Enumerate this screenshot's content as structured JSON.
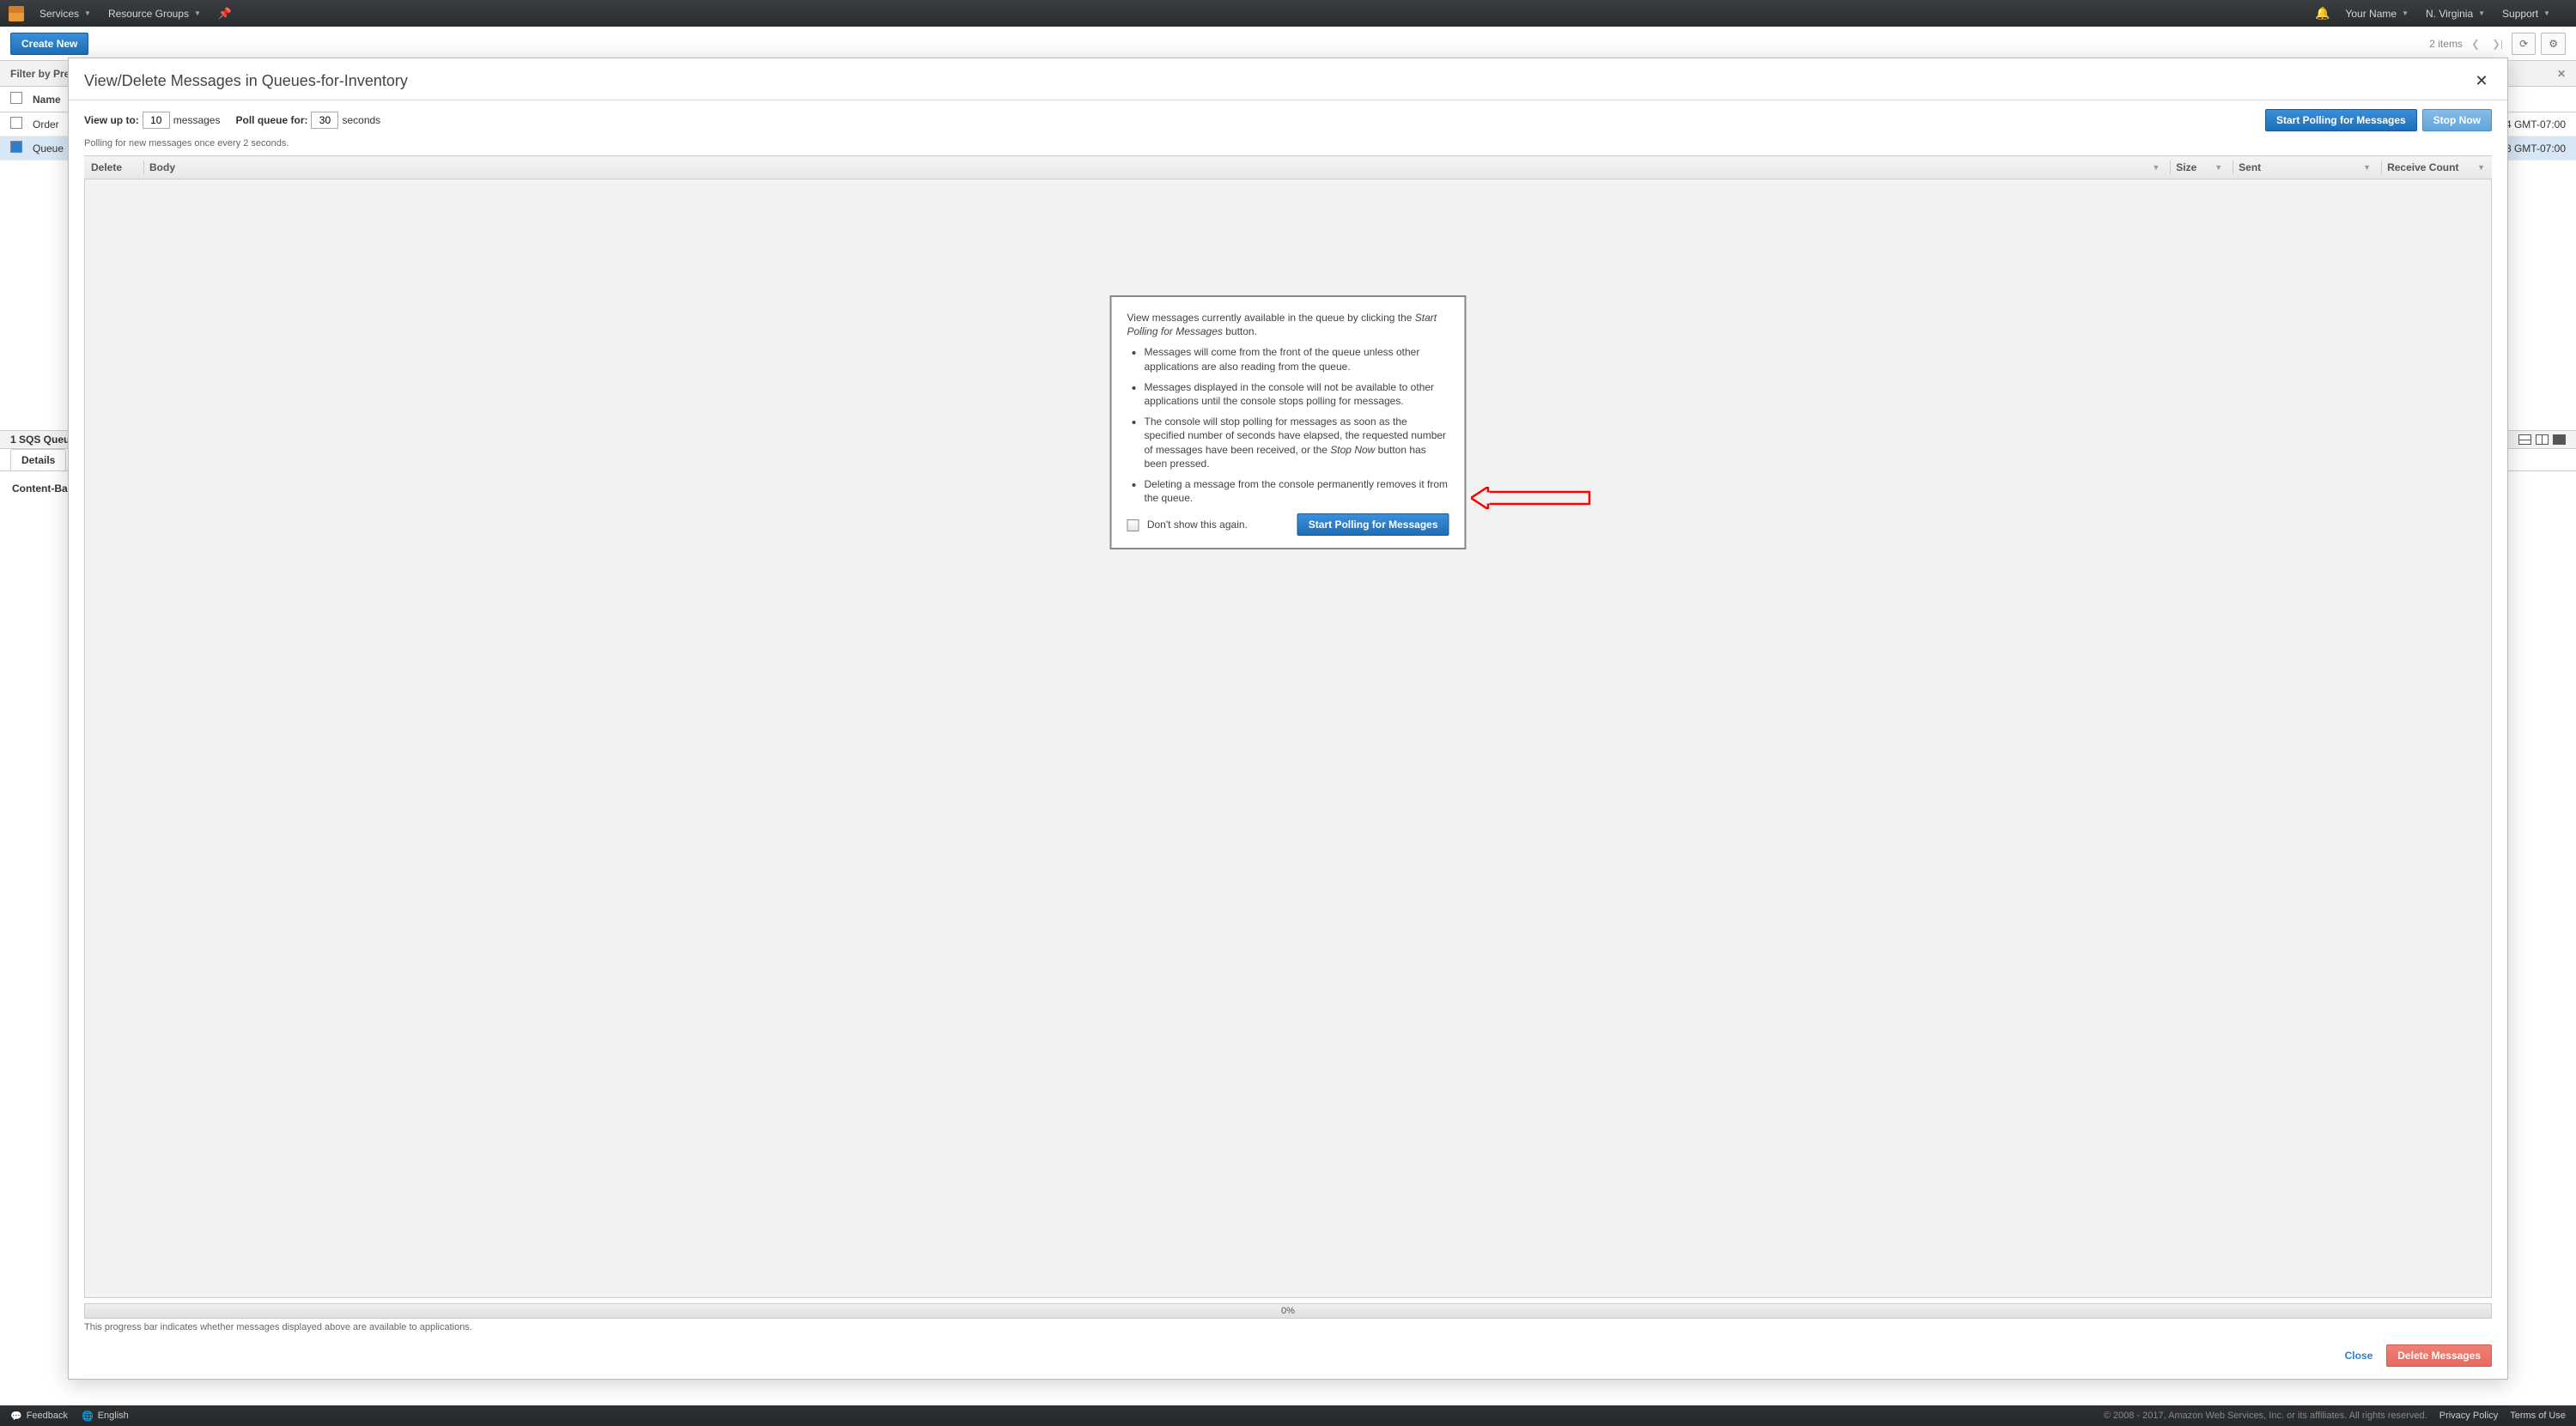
{
  "nav": {
    "services": "Services",
    "resource_groups": "Resource Groups",
    "user": "Your Name",
    "region": "N. Virginia",
    "support": "Support"
  },
  "toolbar": {
    "create": "Create New",
    "items_label": "items",
    "items_count": "2"
  },
  "filter": {
    "label": "Filter by Pre"
  },
  "queues_table": {
    "col_name": "Name",
    "rows": [
      {
        "name": "Order",
        "date": "4 GMT-07:00",
        "checked": false
      },
      {
        "name": "Queue",
        "date": "3 GMT-07:00",
        "checked": true
      }
    ]
  },
  "split": {
    "label": "1 SQS Queue"
  },
  "tabs": {
    "details": "Details"
  },
  "detail": {
    "content_based": "Content-Ba"
  },
  "footer": {
    "feedback": "Feedback",
    "english": "English",
    "copyright": "© 2008 - 2017, Amazon Web Services, Inc. or its affiliates. All rights reserved.",
    "privacy": "Privacy Policy",
    "terms": "Terms of Use"
  },
  "modal": {
    "title": "View/Delete Messages in Queues-for-Inventory",
    "view_up_to": "View up to:",
    "view_up_to_value": "10",
    "messages": "messages",
    "poll_for": "Poll queue for:",
    "poll_for_value": "30",
    "seconds": "seconds",
    "start": "Start Polling for Messages",
    "stop": "Stop Now",
    "note": "Polling for new messages once every 2 seconds.",
    "headers": {
      "delete": "Delete",
      "body": "Body",
      "size": "Size",
      "sent": "Sent",
      "recv": "Receive Count"
    },
    "info": {
      "intro_a": "View messages currently available in the queue by clicking the ",
      "intro_b_i": "Start Polling for Messages",
      "intro_c": " button.",
      "b1": "Messages will come from the front of the queue unless other applications are also reading from the queue.",
      "b2": "Messages displayed in the console will not be available to other applications until the console stops polling for messages.",
      "b3a": "The console will stop polling for messages as soon as the specified number of seconds have elapsed, the requested number of messages have been received, or the ",
      "b3i": "Stop Now",
      "b3b": " button has been pressed.",
      "b4": "Deleting a message from the console permanently removes it from the queue.",
      "dont_show": "Don't show this again.",
      "start": "Start Polling for Messages"
    },
    "progress_pct": "0%",
    "progress_note": "This progress bar indicates whether messages displayed above are available to applications.",
    "close": "Close",
    "delete_msgs": "Delete Messages"
  }
}
